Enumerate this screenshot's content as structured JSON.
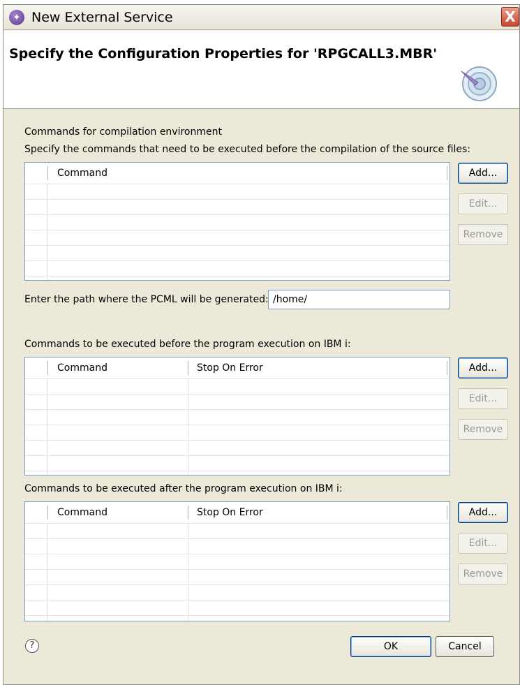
{
  "window": {
    "title": "New External Service",
    "close_glyph": "X",
    "icon": "wizard-icon"
  },
  "banner": {
    "title": "Specify the Configuration Properties for 'RPGCALL3.MBR'",
    "graphic_icon": "configure-wizard-icon"
  },
  "compilation": {
    "section_label": "Commands for compilation environment",
    "instruction": "Specify the commands that need to be executed before the compilation of the source files:",
    "columns": [
      "Command"
    ],
    "rows": []
  },
  "pcml": {
    "label": "Enter the path where the PCML will be generated:",
    "value": "/home/"
  },
  "before_exec": {
    "label": "Commands to be executed before the program execution on IBM i:",
    "columns": [
      "Command",
      "Stop On Error"
    ],
    "rows": []
  },
  "after_exec": {
    "label": "Commands to be executed after the program execution on IBM i:",
    "columns": [
      "Command",
      "Stop On Error"
    ],
    "rows": []
  },
  "buttons": {
    "add": "Add...",
    "edit": "Edit...",
    "remove": "Remove"
  },
  "footer": {
    "help_glyph": "?",
    "ok": "OK",
    "cancel": "Cancel"
  },
  "colors": {
    "dialog_bg": "#ece9d8",
    "table_border": "#7f9db9",
    "disabled_text": "#9a9a9a"
  }
}
